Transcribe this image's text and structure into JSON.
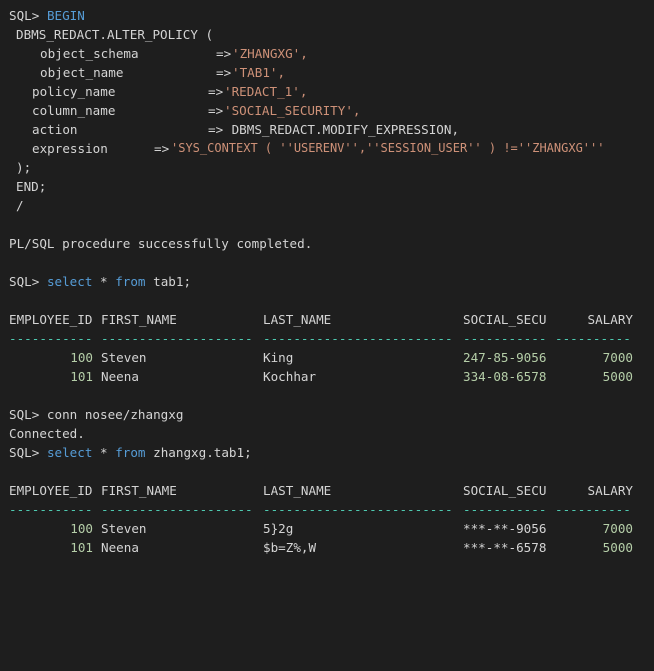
{
  "colors": {
    "background": "#1e1e1e",
    "text": "#d4d4d4",
    "keyword": "#569cd6",
    "string": "#ce9178",
    "number": "#b5cea8",
    "separator": "#4ec9b0"
  },
  "prompt": "SQL>",
  "block": {
    "begin": "BEGIN",
    "call": "DBMS_REDACT.ALTER_POLICY (",
    "params": [
      {
        "name": "object_schema",
        "arrow": "=>",
        "value": "'ZHANGXG',"
      },
      {
        "name": "object_name",
        "arrow": "=>",
        "value": "'TAB1',"
      },
      {
        "name": "policy_name",
        "arrow": "=>",
        "value": "'REDACT_1',"
      },
      {
        "name": "column_name",
        "arrow": "=>",
        "value": "'SOCIAL_SECURITY',"
      },
      {
        "name": "action",
        "arrow": "=>",
        "value": " DBMS_REDACT.MODIFY_EXPRESSION,"
      },
      {
        "name": "expression",
        "arrow": "=>",
        "value": "'SYS_CONTEXT ( ''USERENV'',''SESSION_USER'' ) !=''ZHANGXG'''"
      }
    ],
    "close": ");",
    "end": "END;",
    "slash": "/"
  },
  "success_msg": "PL/SQL procedure successfully completed.",
  "query1": {
    "select": "select",
    "star": " * ",
    "from": "from",
    "rest": " tab1;"
  },
  "columns": [
    "EMPLOYEE_ID",
    "FIRST_NAME",
    "LAST_NAME",
    "SOCIAL_SECU",
    "SALARY"
  ],
  "separators": [
    "-----------",
    "--------------------",
    "-------------------------",
    "-----------",
    "----------"
  ],
  "table1": [
    {
      "id": "100",
      "first": "Steven",
      "last": "King",
      "ssn": "247-85-9056",
      "salary": "7000"
    },
    {
      "id": "101",
      "first": "Neena",
      "last": "Kochhar",
      "ssn": "334-08-6578",
      "salary": "5000"
    }
  ],
  "conn_cmd": " conn nosee/zhangxg",
  "connected": "Connected.",
  "query2": {
    "select": "select",
    "star": " * ",
    "from": "from",
    "rest": " zhangxg.tab1;"
  },
  "table2": [
    {
      "id": "100",
      "first": "Steven",
      "last": "5}2g",
      "ssn": "***-**-9056",
      "salary": "7000"
    },
    {
      "id": "101",
      "first": "Neena",
      "last": "$b=Z%,W",
      "ssn": "***-**-6578",
      "salary": "5000"
    }
  ]
}
